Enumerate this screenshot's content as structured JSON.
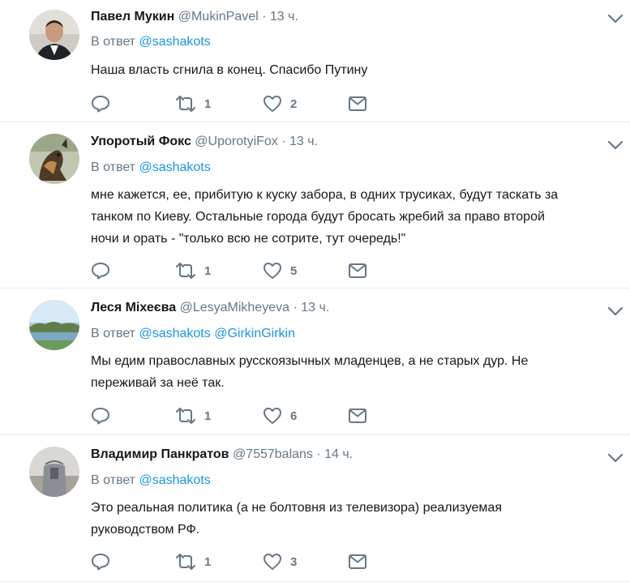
{
  "tweets": [
    {
      "name": "Павел Мукин",
      "handle": "@MukinPavel",
      "sep": "·",
      "time": "13 ч.",
      "reply_prefix": "В ответ",
      "reply_to": [
        "@sashakots"
      ],
      "text": [
        "Наша власть сгнила в конец. Спасибо Путину"
      ],
      "retweets": "1",
      "likes": "2"
    },
    {
      "name": "Упоротый Фокс",
      "handle": "@UporotyiFox",
      "sep": "·",
      "time": "13 ч.",
      "reply_prefix": "В ответ",
      "reply_to": [
        "@sashakots"
      ],
      "text": [
        "мне кажется, ее, прибитую к куску забора, в одних трусиках, будут таскать за",
        "танком по Киеву. Остальные города будут бросать жребий за право второй",
        "ночи и орать - \"только всю не сотрите, тут очередь!\""
      ],
      "retweets": "1",
      "likes": "5"
    },
    {
      "name": "Леся Міхеєва",
      "handle": "@LesyaMikheyeva",
      "sep": "·",
      "time": "13 ч.",
      "reply_prefix": "В ответ",
      "reply_to": [
        "@sashakots",
        "@GirkinGirkin"
      ],
      "text": [
        "Мы едим православных русскоязычных младенцев, а не старых дур. Не",
        "переживай за неё так."
      ],
      "retweets": "1",
      "likes": "6"
    },
    {
      "name": "Владимир Панкратов",
      "handle": "@7557balans",
      "sep": "·",
      "time": "14 ч.",
      "reply_prefix": "В ответ",
      "reply_to": [
        "@sashakots"
      ],
      "text": [
        "Это реальная политика (а не болтовня из телевизора) реализуемая",
        "руководством РФ."
      ],
      "retweets": "1",
      "likes": "3"
    }
  ],
  "icons": {
    "reply": "reply-icon",
    "retweet": "retweet-icon",
    "like": "heart-icon",
    "dm": "envelope-icon",
    "more": "chevron-down-icon"
  },
  "colors": {
    "link": "#1b95e0",
    "muted": "#657786",
    "text": "#14171a",
    "divider": "#e6ecf0"
  }
}
